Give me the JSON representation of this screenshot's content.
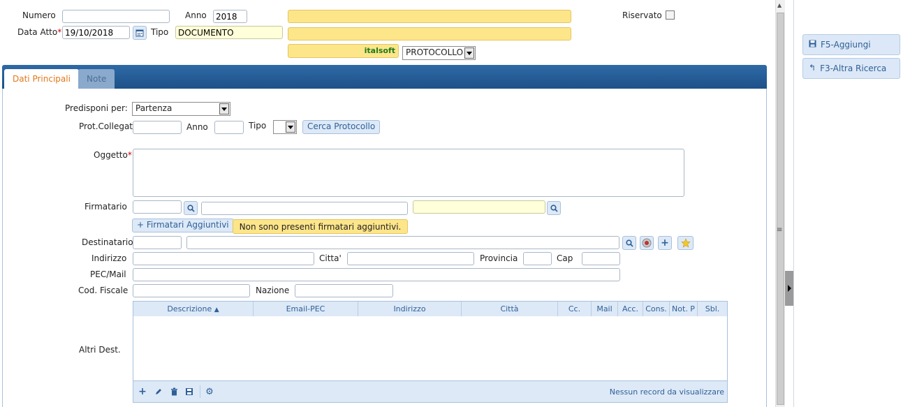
{
  "header": {
    "numero_label": "Numero",
    "numero_value": "",
    "anno_label": "Anno",
    "anno_value": "2018",
    "data_atto_label": "Data Atto",
    "data_atto_value": "19/10/2018",
    "tipo_label": "Tipo",
    "tipo_value": "DOCUMENTO",
    "riservato_label": "Riservato",
    "italsoft_label": "italsoft",
    "protocollo_select": "PROTOCOLLO"
  },
  "tabs": [
    {
      "label": "Dati Principali",
      "active": true
    },
    {
      "label": "Note",
      "active": false
    }
  ],
  "form": {
    "predisponi_label": "Predisponi per:",
    "predisponi_value": "Partenza",
    "prot_collegato_label": "Prot.Collegato",
    "anno_label": "Anno",
    "tipo_label": "Tipo",
    "cerca_protocollo": "Cerca Protocollo",
    "oggetto_label": "Oggetto",
    "firmatario_label": "Firmatario",
    "firmatari_aggiuntivi_btn": "Firmatari Aggiuntivi",
    "firmatari_msg": "Non sono presenti firmatari aggiuntivi.",
    "destinatario_label": "Destinatario",
    "indirizzo_label": "Indirizzo",
    "citta_label": "Citta'",
    "provincia_label": "Provincia",
    "cap_label": "Cap",
    "pec_label": "PEC/Mail",
    "cod_fiscale_label": "Cod. Fiscale",
    "nazione_label": "Nazione",
    "altri_dest_label": "Altri Dest."
  },
  "grid": {
    "columns": [
      "Descrizione",
      "Email-PEC",
      "Indirizzo",
      "Città",
      "Cc.",
      "Mail",
      "Acc.",
      "Cons.",
      "Not. P",
      "Sbl."
    ],
    "empty_msg": "Nessun record da visualizzare"
  },
  "side": {
    "aggiungi": "F5-Aggiungi",
    "altra_ricerca": "F3-Altra Ricerca"
  },
  "colors": {
    "accent": "#2f5f97",
    "tab_bar": "#1d5189",
    "field_yellow": "#fde58a"
  }
}
